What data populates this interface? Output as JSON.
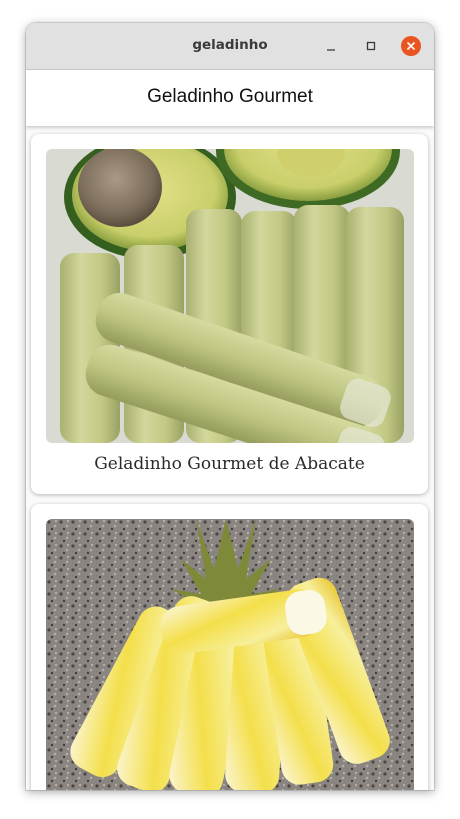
{
  "window": {
    "title": "geladinho"
  },
  "appbar": {
    "title": "Geladinho Gourmet"
  },
  "products": [
    {
      "name": "Geladinho Gourmet de Abacate",
      "image": "avocado-geladinho-photo"
    },
    {
      "name": "",
      "image": "pineapple-geladinho-photo"
    }
  ],
  "colors": {
    "close_button": "#e95420",
    "titlebar": "#e1e1e1",
    "avocado_flesh": "#c7cd8a",
    "pineapple_yellow": "#f2d83a"
  },
  "icons": {
    "minimize": "minimize-icon",
    "maximize": "maximize-icon",
    "close": "close-icon"
  }
}
